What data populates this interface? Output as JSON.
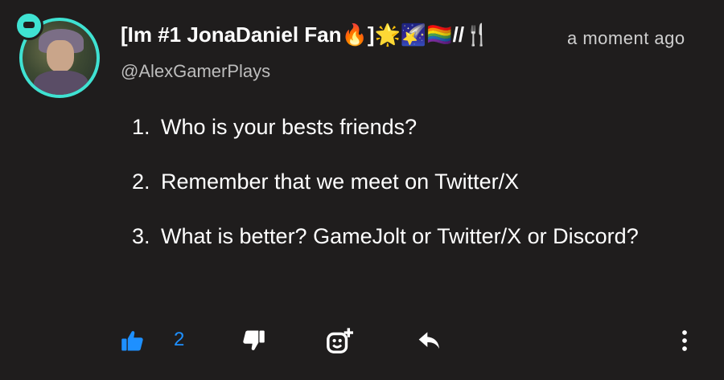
{
  "post": {
    "display_name": "[Im #1 JonaDaniel Fan🔥]🌟🌠🏳️‍🌈//🍴",
    "timestamp": "a moment ago",
    "username": "@AlexGamerPlays",
    "items": [
      "Who is your bests friends?",
      "Remember that we meet on Twitter/X",
      "What is better? GameJolt or Twitter/X or Discord?"
    ]
  },
  "actions": {
    "like_count": "2",
    "like_icon": "thumbs-up-icon",
    "dislike_icon": "thumbs-down-icon",
    "react_icon": "add-emoji-icon",
    "reply_icon": "reply-icon",
    "more_icon": "more-vertical-icon"
  },
  "colors": {
    "background": "#1f1d1d",
    "accent": "#1e90ff",
    "avatar_ring": "#3fe2d2",
    "text": "#ffffff",
    "muted": "#bdbdbd"
  }
}
